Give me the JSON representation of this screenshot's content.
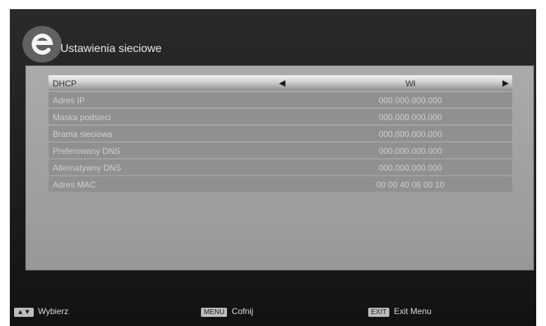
{
  "header": {
    "title": "Ustawienia sieciowe"
  },
  "network_settings": {
    "rows": [
      {
        "label": "DHCP",
        "value": "Wł",
        "selected": true
      },
      {
        "label": "Adres IP",
        "value": "000.000.000.000"
      },
      {
        "label": "Maska podsieci",
        "value": "000.000.000.000"
      },
      {
        "label": "Brama sieciowa",
        "value": "000.000.000.000"
      },
      {
        "label": "Preferowany DNS",
        "value": "000.000.000.000"
      },
      {
        "label": "Alternatywny DNS",
        "value": "000.000.000.000"
      },
      {
        "label": "Adres MAC",
        "value": "00 00 40 06 00 10"
      }
    ]
  },
  "footer": {
    "select_label": "Wybierz",
    "menu_key": "MENU",
    "menu_label": "Cofnij",
    "exit_key": "EXIT",
    "exit_label": "Exit Menu"
  },
  "icons": {
    "logo": "e-logo-icon",
    "left_arrow": "left-arrow-icon",
    "right_arrow": "right-arrow-icon",
    "updown": "updown-arrow-icon"
  }
}
